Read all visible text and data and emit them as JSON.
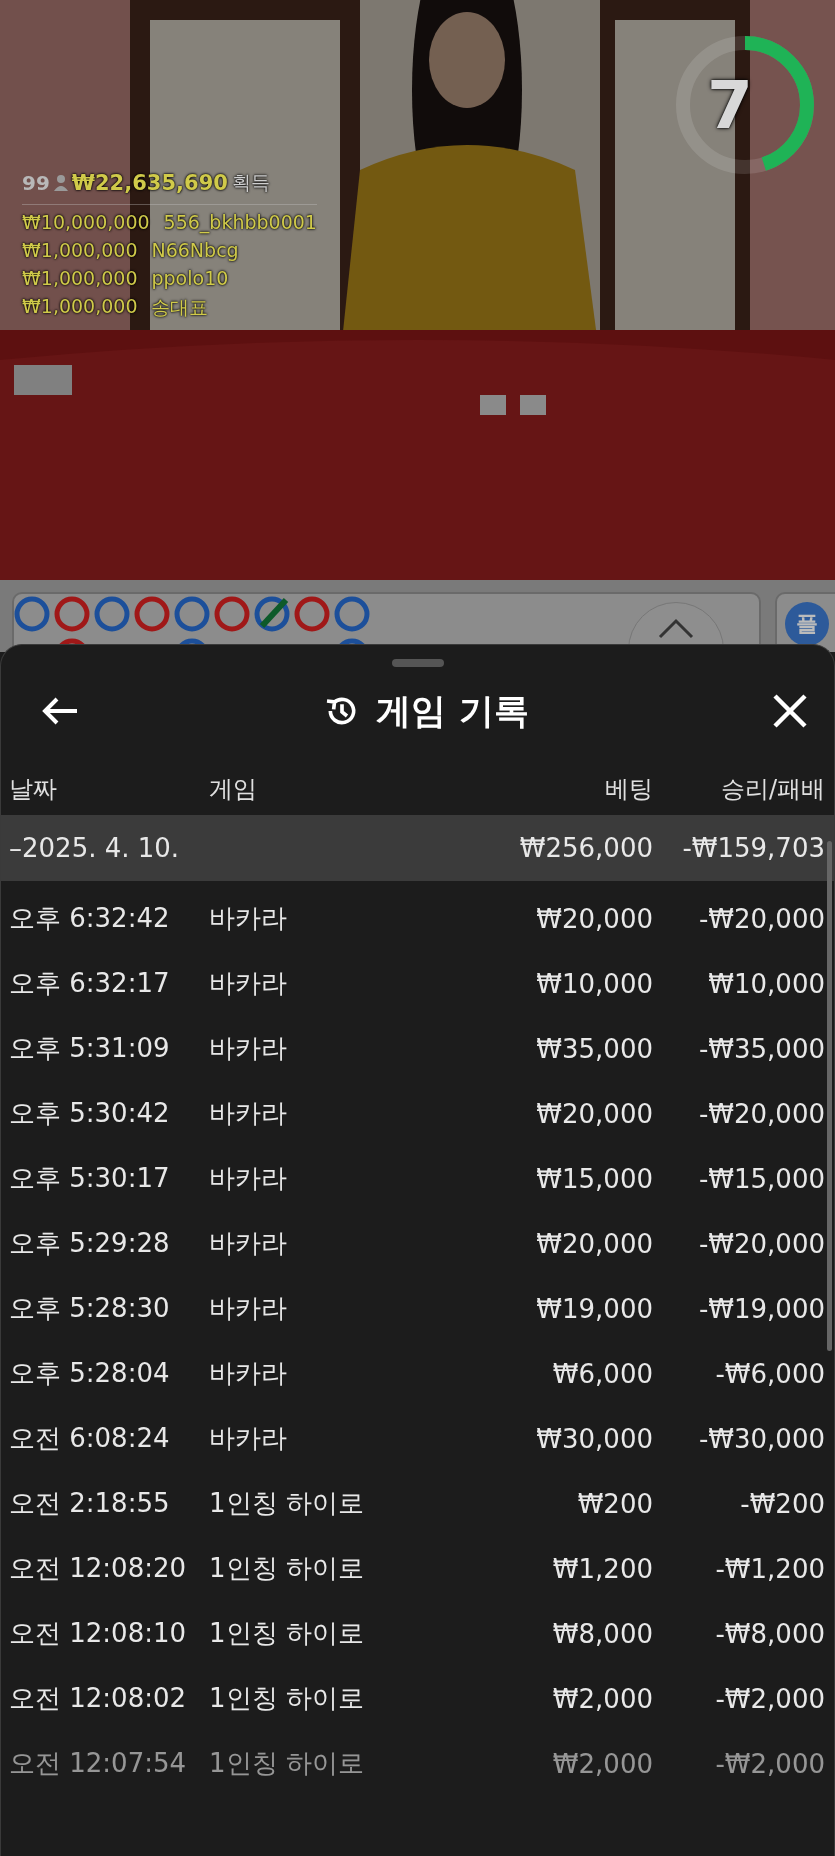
{
  "video": {
    "timer": {
      "value": "7",
      "level": 0.45
    },
    "jackpot": {
      "count": "99",
      "amount": "₩22,635,690",
      "label": "획득"
    },
    "winners": [
      {
        "amount": "₩10,000,000",
        "name": "556_bkhbb0001"
      },
      {
        "amount": "₩1,000,000",
        "name": "N66Nbcg"
      },
      {
        "amount": "₩1,000,000",
        "name": "ppolo10"
      },
      {
        "amount": "₩1,000,000",
        "name": "송대표"
      }
    ]
  },
  "roadmap": {
    "side_button": "플"
  },
  "sheet": {
    "title": "게임 기록",
    "columns": [
      "날짜",
      "게임",
      "베팅",
      "승리/패배"
    ],
    "summary": {
      "toggle": "–",
      "date": "2025. 4. 10.",
      "bet": "₩256,000",
      "result": "-₩159,703"
    },
    "rows": [
      {
        "time": "오후 6:32:42",
        "game": "바카라",
        "bet": "₩20,000",
        "result": "-₩20,000",
        "faded": false
      },
      {
        "time": "오후 6:32:17",
        "game": "바카라",
        "bet": "₩10,000",
        "result": "₩10,000",
        "faded": false
      },
      {
        "time": "오후 5:31:09",
        "game": "바카라",
        "bet": "₩35,000",
        "result": "-₩35,000",
        "faded": false
      },
      {
        "time": "오후 5:30:42",
        "game": "바카라",
        "bet": "₩20,000",
        "result": "-₩20,000",
        "faded": false
      },
      {
        "time": "오후 5:30:17",
        "game": "바카라",
        "bet": "₩15,000",
        "result": "-₩15,000",
        "faded": false
      },
      {
        "time": "오후 5:29:28",
        "game": "바카라",
        "bet": "₩20,000",
        "result": "-₩20,000",
        "faded": false
      },
      {
        "time": "오후 5:28:30",
        "game": "바카라",
        "bet": "₩19,000",
        "result": "-₩19,000",
        "faded": false
      },
      {
        "time": "오후 5:28:04",
        "game": "바카라",
        "bet": "₩6,000",
        "result": "-₩6,000",
        "faded": false
      },
      {
        "time": "오전 6:08:24",
        "game": "바카라",
        "bet": "₩30,000",
        "result": "-₩30,000",
        "faded": false
      },
      {
        "time": "오전 2:18:55",
        "game": "1인칭 하이로",
        "bet": "₩200",
        "result": "-₩200",
        "faded": false
      },
      {
        "time": "오전 12:08:20",
        "game": "1인칭 하이로",
        "bet": "₩1,200",
        "result": "-₩1,200",
        "faded": false
      },
      {
        "time": "오전 12:08:10",
        "game": "1인칭 하이로",
        "bet": "₩8,000",
        "result": "-₩8,000",
        "faded": false
      },
      {
        "time": "오전 12:08:02",
        "game": "1인칭 하이로",
        "bet": "₩2,000",
        "result": "-₩2,000",
        "faded": false
      },
      {
        "time": "오전 12:07:54",
        "game": "1인칭 하이로",
        "bet": "₩2,000",
        "result": "-₩2,000",
        "faded": true
      }
    ]
  }
}
